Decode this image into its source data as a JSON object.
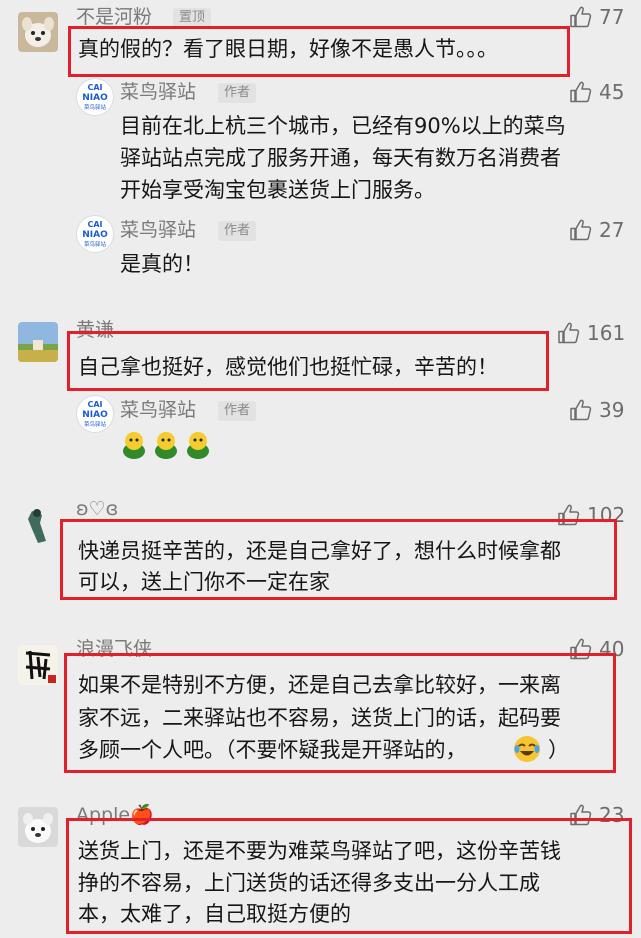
{
  "comments": [
    {
      "author": "不是河粉",
      "tag": "置顶",
      "likes": "77",
      "text": "真的假的？看了眼日期，好像不是愚人节。。。",
      "replies": [
        {
          "author": "菜鸟驿站",
          "tag": "作者",
          "likes": "45",
          "lines": [
            "目前在北上杭三个城市，已经有90%以上的菜鸟",
            "驿站站点完成了服务开通，每天有数万名消费者",
            "开始享受淘宝包裹送货上门服务。"
          ]
        },
        {
          "author": "菜鸟驿站",
          "tag": "作者",
          "likes": "27",
          "lines": [
            "是真的！"
          ]
        }
      ]
    },
    {
      "author": "黄谦",
      "likes": "161",
      "text": "自己拿也挺好，感觉他们也挺忙碌，辛苦的！",
      "replies": [
        {
          "author": "菜鸟驿站",
          "tag": "作者",
          "likes": "39"
        }
      ]
    },
    {
      "author": "ʚ♡ɞ",
      "likes": "102",
      "lines": [
        "快递员挺辛苦的，还是自己拿好了，想什么时候拿都",
        "可以，送上门你不一定在家"
      ]
    },
    {
      "author": "浪漫飞侠",
      "likes": "40",
      "lines": [
        "如果不是特别不方便，还是自己去拿比较好，一来离",
        "家不远，二来驿站也不容易，送货上门的话，起码要",
        "多顾一个人吧。（不要怀疑我是开驿站的，",
        "）"
      ]
    },
    {
      "author": "Apple🍎",
      "likes": "23",
      "lines": [
        "送货上门，还是不要为难菜鸟驿站了吧，这份辛苦钱",
        "挣的不容易，上门送货的话还得多支出一分人工成",
        "本，太难了，自己取挺方便的"
      ]
    }
  ],
  "logo": {
    "line1": "CAI",
    "line2": "NIAO",
    "line3": "菜鸟驿站"
  },
  "colors": {
    "highlight": "#e0202a",
    "background": "#ededed",
    "logo_blue": "#1c5bd6"
  },
  "icons": {
    "like": "thumbs-up-icon",
    "emoji_green": "green-blob-emoji",
    "emoji_laugh": "tears-of-joy-emoji"
  }
}
